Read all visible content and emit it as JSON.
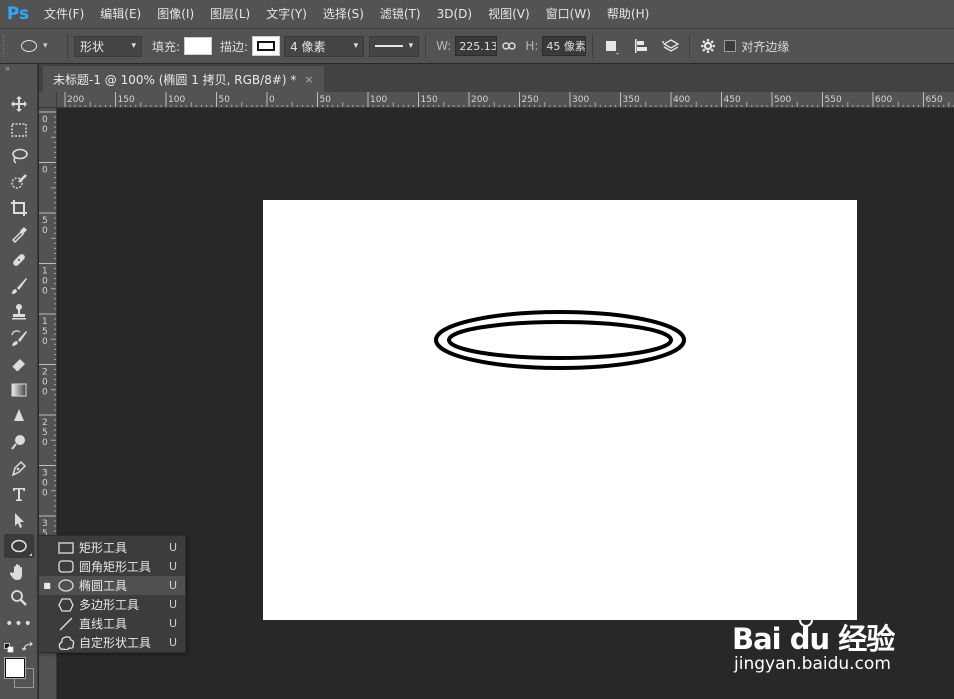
{
  "app": {
    "logo": "Ps",
    "brand_color": "#31a8ff"
  },
  "menu": [
    "文件(F)",
    "编辑(E)",
    "图像(I)",
    "图层(L)",
    "文字(Y)",
    "选择(S)",
    "滤镜(T)",
    "3D(D)",
    "视图(V)",
    "窗口(W)",
    "帮助(H)"
  ],
  "options": {
    "mode_value": "形状",
    "fill_label": "填充:",
    "stroke_label": "描边:",
    "stroke_width_value": "4 像素",
    "w_label": "W:",
    "w_value": "225.13 像",
    "h_label": "H:",
    "h_value": "45 像素",
    "align_edges_label": "对齐边缘",
    "align_edges_checked": false
  },
  "document": {
    "tab_title": "未标题-1 @ 100% (椭圆 1 拷贝, RGB/8#) *",
    "close_glyph": "×"
  },
  "ruler": {
    "h_labels": [
      "200",
      "150",
      "100",
      "50",
      "0",
      "50",
      "100",
      "150",
      "200",
      "250",
      "300",
      "350",
      "400",
      "450",
      "500",
      "550",
      "600",
      "650"
    ],
    "v_labels": [
      [
        "0",
        "0"
      ],
      [
        "0"
      ],
      [
        "5",
        "0"
      ],
      [
        "1",
        "0",
        "0"
      ],
      [
        "1",
        "5",
        "0"
      ],
      [
        "2",
        "0",
        "0"
      ],
      [
        "2",
        "5",
        "0"
      ],
      [
        "3",
        "0",
        "0"
      ],
      [
        "3",
        "5",
        "0"
      ]
    ]
  },
  "flyout": {
    "items": [
      {
        "label": "矩形工具",
        "key": "U",
        "icon": "rectangle-icon",
        "selected": false
      },
      {
        "label": "圆角矩形工具",
        "key": "U",
        "icon": "rounded-rectangle-icon",
        "selected": false
      },
      {
        "label": "椭圆工具",
        "key": "U",
        "icon": "ellipse-icon",
        "selected": true
      },
      {
        "label": "多边形工具",
        "key": "U",
        "icon": "polygon-icon",
        "selected": false
      },
      {
        "label": "直线工具",
        "key": "U",
        "icon": "line-icon",
        "selected": false
      },
      {
        "label": "自定形状工具",
        "key": "U",
        "icon": "custom-shape-icon",
        "selected": false
      }
    ]
  },
  "colors": {
    "foreground": "#ffffff",
    "background": "#ffffff"
  },
  "watermark": {
    "brand": "Bai du 经验",
    "url": "jingyan.baidu.com"
  }
}
